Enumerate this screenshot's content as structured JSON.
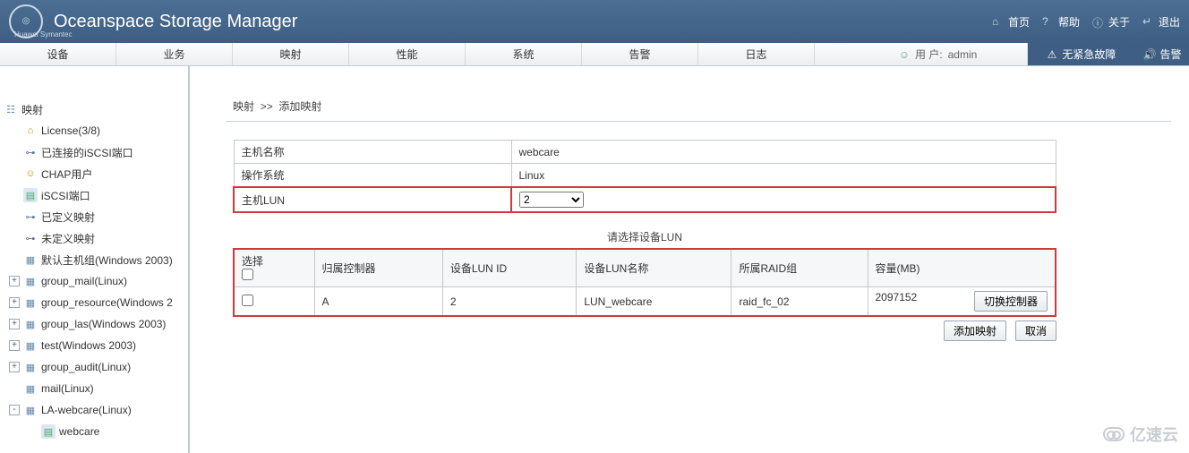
{
  "brand": {
    "logo_text": "Huawei\nSymantec",
    "app_title": "Oceanspace Storage Manager"
  },
  "header_links": {
    "home": "首页",
    "help": "帮助",
    "about": "关于",
    "logout": "退出"
  },
  "nav": {
    "items": [
      "设备",
      "业务",
      "映射",
      "性能",
      "系统",
      "告警",
      "日志"
    ],
    "user_prefix": "用 户:",
    "user_name": "admin",
    "no_fault": "无紧急故障",
    "alarm": "告警"
  },
  "tree": {
    "root": "映射",
    "items": [
      {
        "label": "License(3/8)",
        "icon": "key"
      },
      {
        "label": "已连接的iSCSI端口",
        "icon": "port"
      },
      {
        "label": "CHAP用户",
        "icon": "user"
      },
      {
        "label": "iSCSI端口",
        "icon": "doc"
      },
      {
        "label": "已定义映射",
        "icon": "port"
      },
      {
        "label": "未定义映射",
        "icon": "port"
      },
      {
        "label": "默认主机组(Windows 2003)",
        "icon": "grp"
      },
      {
        "label": "group_mail(Linux)",
        "icon": "grp",
        "toggle": "+"
      },
      {
        "label": "group_resource(Windows 2",
        "icon": "grp",
        "toggle": "+"
      },
      {
        "label": "group_las(Windows 2003)",
        "icon": "grp",
        "toggle": "+"
      },
      {
        "label": "test(Windows 2003)",
        "icon": "grp",
        "toggle": "+"
      },
      {
        "label": "group_audit(Linux)",
        "icon": "grp",
        "toggle": "+"
      },
      {
        "label": "mail(Linux)",
        "icon": "grp"
      },
      {
        "label": "LA-webcare(Linux)",
        "icon": "grp",
        "toggle": "-",
        "children": [
          {
            "label": "webcare",
            "icon": "doc",
            "selected": false
          }
        ]
      }
    ]
  },
  "breadcrumb": {
    "a": "映射",
    "sep": ">>",
    "b": "添加映射"
  },
  "form": {
    "host_name_label": "主机名称",
    "host_name_value": "webcare",
    "os_label": "操作系统",
    "os_value": "Linux",
    "host_lun_label": "主机LUN",
    "host_lun_value": "2"
  },
  "section_title": "请选择设备LUN",
  "table": {
    "headers": {
      "select": "选择",
      "controller": "归属控制器",
      "lunid": "设备LUN ID",
      "lunname": "设备LUN名称",
      "raid": "所属RAID组",
      "capacity": "容量(MB)"
    },
    "rows": [
      {
        "controller": "A",
        "lunid": "2",
        "lunname": "LUN_webcare",
        "raid": "raid_fc_02",
        "capacity": "2097152"
      }
    ]
  },
  "buttons": {
    "switch": "切换控制器",
    "add": "添加映射",
    "cancel": "取消"
  },
  "watermark": "亿速云"
}
